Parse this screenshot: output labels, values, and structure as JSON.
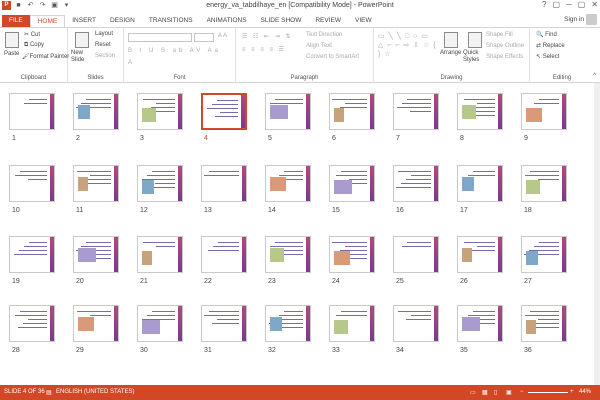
{
  "window": {
    "title": "energy_va_tabdilhaye_en [Compatibility Mode] - PowerPoint",
    "controls": [
      "?",
      "▢",
      "─",
      "▢",
      "✕"
    ]
  },
  "tabs": [
    "FILE",
    "HOME",
    "INSERT",
    "DESIGN",
    "TRANSITIONS",
    "ANIMATIONS",
    "SLIDE SHOW",
    "REVIEW",
    "VIEW"
  ],
  "account": {
    "signin": "Sign in"
  },
  "ribbon": {
    "clipboard": {
      "label": "Clipboard",
      "paste": "Paste",
      "cut": "Cut",
      "copy": "Copy",
      "format_painter": "Format Painter"
    },
    "slides": {
      "label": "Slides",
      "new_slide": "New Slide",
      "layout": "Layout",
      "reset": "Reset",
      "section": "Section"
    },
    "font": {
      "label": "Font"
    },
    "paragraph": {
      "label": "Paragraph",
      "text_direction": "Text Direction",
      "align_text": "Align Text",
      "convert": "Convert to SmartArt"
    },
    "drawing": {
      "label": "Drawing",
      "arrange": "Arrange",
      "quick_styles": "Quick Styles",
      "shape_fill": "Shape Fill",
      "shape_outline": "Shape Outline",
      "shape_effects": "Shape Effects"
    },
    "editing": {
      "label": "Editing",
      "find": "Find",
      "replace": "Replace",
      "select": "Select"
    }
  },
  "slides": [
    "1",
    "2",
    "3",
    "4",
    "5",
    "6",
    "7",
    "8",
    "9",
    "10",
    "11",
    "12",
    "13",
    "14",
    "15",
    "16",
    "17",
    "18",
    "19",
    "20",
    "21",
    "22",
    "23",
    "24",
    "25",
    "26",
    "27",
    "28",
    "29",
    "30",
    "31",
    "32",
    "33",
    "34",
    "35",
    "36"
  ],
  "selected_slide": "4",
  "status": {
    "slide": "SLIDE 4 OF 36",
    "language": "ENGLISH (UNITED STATES)",
    "zoom": "44%"
  },
  "colors": {
    "accent": "#d24726",
    "slide_bar": "#9b3f82"
  }
}
